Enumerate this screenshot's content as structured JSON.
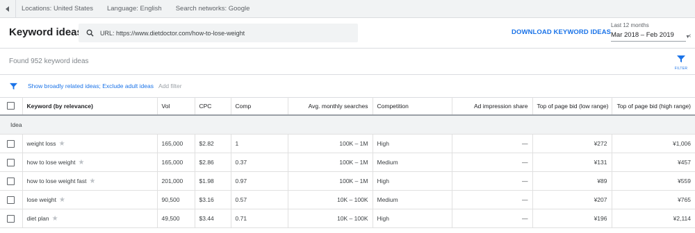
{
  "topbar": {
    "locations": "Locations: United States",
    "language": "Language: English",
    "networks": "Search networks: Google"
  },
  "header": {
    "title": "Keyword ideas",
    "search_value": "URL: https://www.dietdoctor.com/how-to-lose-weight",
    "download_label": "DOWNLOAD KEYWORD IDEAS",
    "date_label": "Last 12 months",
    "date_value": "Mar 2018 – Feb 2019"
  },
  "summary": {
    "found_text": "Found 952 keyword ideas",
    "filter_button_label": "FILTER"
  },
  "filter_bar": {
    "active_filters": "Show broadly related ideas; Exclude adult ideas",
    "add_filter": "Add filter"
  },
  "table": {
    "headers": [
      "Keyword (by relevance)",
      "Vol",
      "CPC",
      "Comp",
      "Avg. monthly searches",
      "Competition",
      "Ad impression share",
      "Top of page bid (low range)",
      "Top of page bid (high range)"
    ],
    "group_label": "Idea",
    "rows": [
      {
        "keyword": "weight loss",
        "vol": "165,000",
        "cpc": "$2.82",
        "comp": "1",
        "avg": "100K – 1M",
        "competition": "High",
        "impr": "—",
        "low": "¥272",
        "high": "¥1,006"
      },
      {
        "keyword": "how to lose weight",
        "vol": "165,000",
        "cpc": "$2.86",
        "comp": "0.37",
        "avg": "100K – 1M",
        "competition": "Medium",
        "impr": "—",
        "low": "¥131",
        "high": "¥457"
      },
      {
        "keyword": "how to lose weight fast",
        "vol": "201,000",
        "cpc": "$1.98",
        "comp": "0.97",
        "avg": "100K – 1M",
        "competition": "High",
        "impr": "—",
        "low": "¥89",
        "high": "¥559"
      },
      {
        "keyword": "lose weight",
        "vol": "90,500",
        "cpc": "$3.16",
        "comp": "0.57",
        "avg": "10K – 100K",
        "competition": "Medium",
        "impr": "—",
        "low": "¥207",
        "high": "¥765"
      },
      {
        "keyword": "diet plan",
        "vol": "49,500",
        "cpc": "$3.44",
        "comp": "0.71",
        "avg": "10K – 100K",
        "competition": "High",
        "impr": "—",
        "low": "¥196",
        "high": "¥2,114"
      }
    ]
  },
  "colors": {
    "accent": "#1a73e8",
    "topbar_bg": "#f1f3f4"
  }
}
